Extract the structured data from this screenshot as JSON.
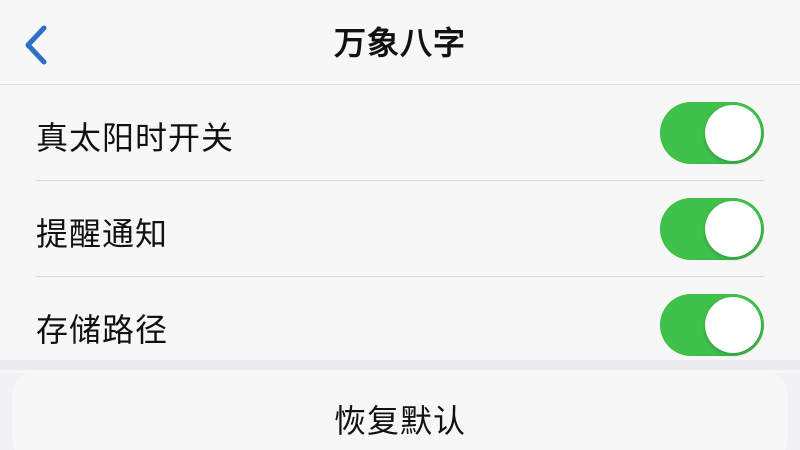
{
  "nav": {
    "title": "万象八字",
    "back_icon": "chevron-left-icon"
  },
  "settings": [
    {
      "label": "真太阳时开关",
      "enabled": true
    },
    {
      "label": "提醒通知",
      "enabled": true
    },
    {
      "label": "存储路径",
      "enabled": true
    }
  ],
  "reset": {
    "label": "恢复默认"
  },
  "colors": {
    "accent": "#2f6fc6",
    "toggle_on": "#3fc24a",
    "background": "#f1f1f3",
    "card": "#f7f7f8"
  }
}
